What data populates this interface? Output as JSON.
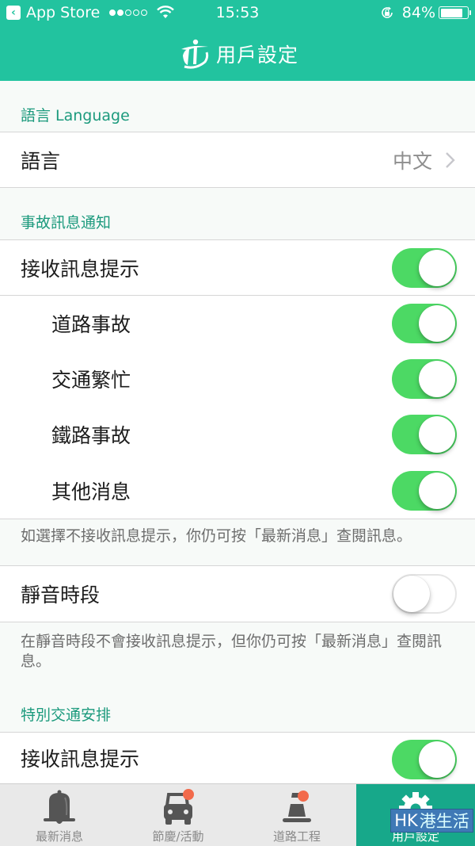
{
  "status_bar": {
    "back_app": "App Store",
    "signal_bars_filled": 2,
    "signal_bars_total": 5,
    "time": "15:53",
    "battery_percent_label": "84%",
    "battery_level": 0.84
  },
  "header": {
    "title": "用戶設定",
    "logo_icon": "transport-logo-icon"
  },
  "sections": {
    "language": {
      "header": "語言 Language",
      "row_label": "語言",
      "row_value": "中文"
    },
    "incident": {
      "header": "事故訊息通知",
      "master_label": "接收訊息提示",
      "master_on": true,
      "items": [
        {
          "label": "道路事故",
          "on": true
        },
        {
          "label": "交通繁忙",
          "on": true
        },
        {
          "label": "鐵路事故",
          "on": true
        },
        {
          "label": "其他消息",
          "on": true
        }
      ],
      "footnote": "如選擇不接收訊息提示，你仍可按「最新消息」查閱訊息。"
    },
    "quiet": {
      "label": "靜音時段",
      "on": false,
      "footnote": "在靜音時段不會接收訊息提示，但你仍可按「最新消息」查閱訊息。"
    },
    "special": {
      "header": "特別交通安排",
      "master_label": "接收訊息提示",
      "master_on": true
    }
  },
  "tabbar": {
    "tabs": [
      {
        "label": "最新消息",
        "icon": "bell-icon",
        "badge": false,
        "active": false
      },
      {
        "label": "節慶/活動",
        "icon": "car-icon",
        "badge": true,
        "active": false
      },
      {
        "label": "道路工程",
        "icon": "traffic-cone-icon",
        "badge": true,
        "active": false
      },
      {
        "label": "用戶設定",
        "icon": "gear-icon",
        "badge": false,
        "active": true
      }
    ]
  },
  "colors": {
    "brand": "#22c39f",
    "section_header": "#1c9a7d",
    "toggle_on": "#4cd964",
    "badge": "#f26a4b",
    "active_tab": "#17a88a"
  },
  "watermark": {
    "latin": "HK",
    "chinese": "港生活"
  }
}
